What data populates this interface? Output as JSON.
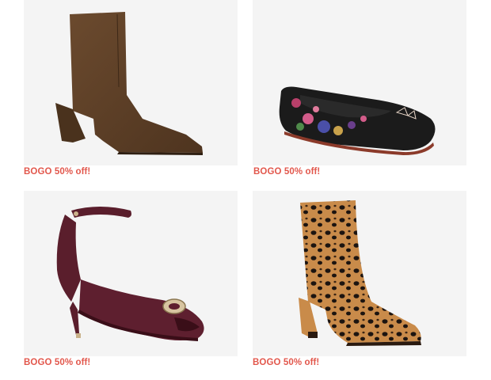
{
  "products": [
    {
      "image": "brown-suede-ankle-boot",
      "promo": "BOGO 50% off!"
    },
    {
      "image": "floral-print-ballet-flat",
      "promo": "BOGO 50% off!"
    },
    {
      "image": "burgundy-ankle-strap-sandal",
      "promo": "BOGO 50% off!"
    },
    {
      "image": "leopard-print-ankle-boot",
      "promo": "BOGO 50% off!"
    }
  ],
  "colors": {
    "promo_text": "#e2574c",
    "image_bg": "#f4f4f4"
  }
}
